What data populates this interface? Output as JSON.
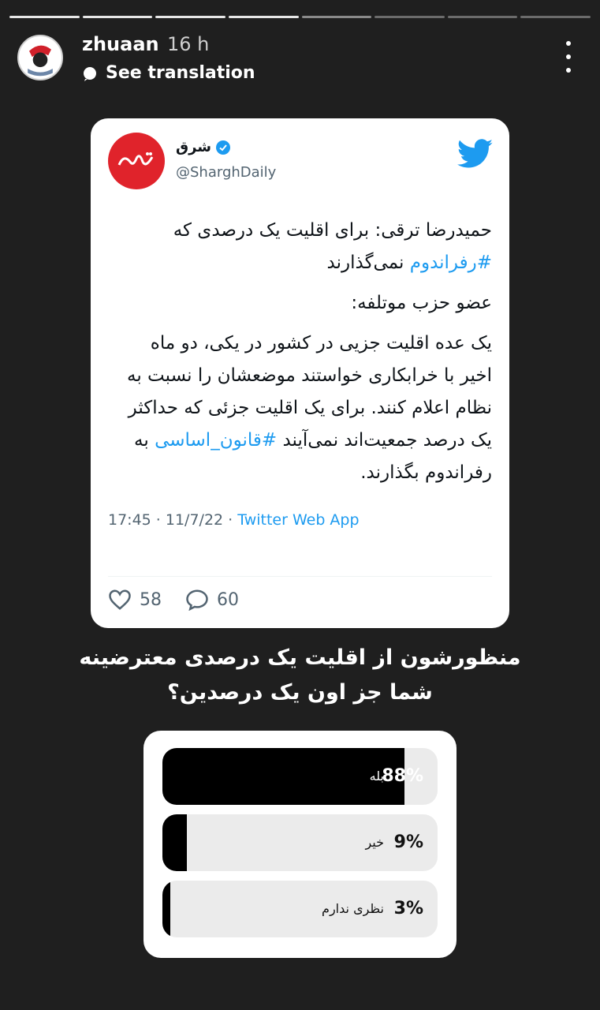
{
  "story": {
    "progress_segments": 8,
    "progress_done": 4,
    "progress_active_index": 4
  },
  "header": {
    "username": "zhuaan",
    "time": "16 h",
    "translate_label": "See translation",
    "more_icon": "more-vertical-icon"
  },
  "tweet": {
    "display_name": "شرق",
    "handle": "@SharghDaily",
    "paragraphs": [
      {
        "text": "حمیدرضا ترقی: برای اقلیت یک درصدی که ",
        "hashtag": "#رفراندوم",
        "after": " نمی‌گذارند"
      },
      {
        "text": "عضو حزب موتلفه:",
        "hashtag": "",
        "after": ""
      },
      {
        "text": "یک عده اقلیت جزیی در کشور در یکی، دو ماه اخیر با خرابکاری خواستند موضعشان را نسبت به نظام اعلام کنند. برای یک اقلیت جزئی که حداکثر یک درصد جمعیت‌اند نمی‌آیند ",
        "hashtag": "#قانون_اساسی",
        "after": " به رفراندوم بگذارند."
      }
    ],
    "timestamp": "17:45 · 11/7/22 · ",
    "source": "Twitter Web App",
    "likes": "58",
    "replies": "60"
  },
  "question": "منظورشون از اقلیت یک درصدی معترضینه شما جز اون یک درصدین؟",
  "poll": {
    "options": [
      {
        "label": "بله",
        "percent": "88%",
        "fraction": 0.88
      },
      {
        "label": "خیر",
        "percent": "9%",
        "fraction": 0.09
      },
      {
        "label": "نظری ندارم",
        "percent": "3%",
        "fraction": 0.03
      }
    ]
  },
  "colors": {
    "background": "#1f1f1f",
    "twitter_blue": "#1d9bf0",
    "shargh_red": "#e0232b"
  }
}
